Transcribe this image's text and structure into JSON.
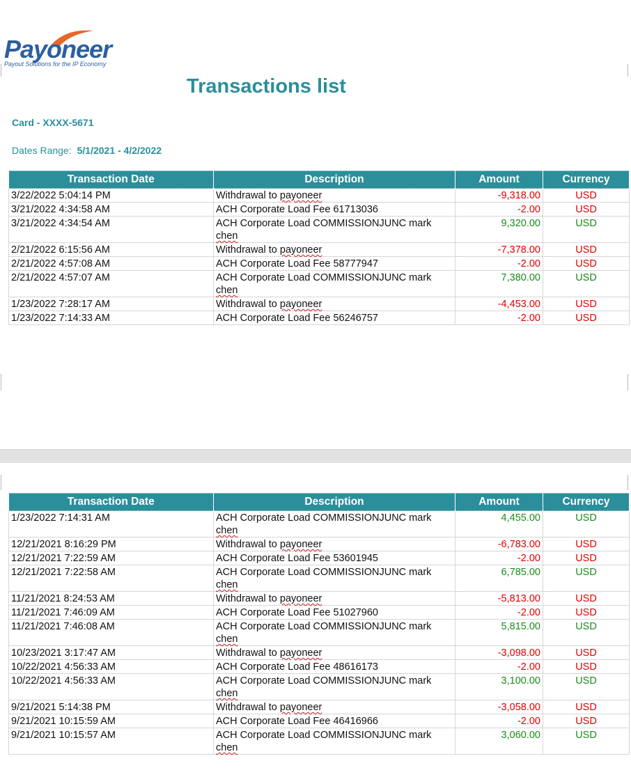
{
  "brand": {
    "name": "Payoneer",
    "tagline": "Payout Solutions for the IP Economy"
  },
  "title": "Transactions list",
  "card": "Card - XXXX-5671",
  "dates_range": {
    "label": "Dates Range:",
    "value": "5/1/2021 - 4/2/2022"
  },
  "columns": [
    "Transaction Date",
    "Description",
    "Amount",
    "Currency"
  ],
  "colors": {
    "header": "#2a8f9b",
    "negative": "#e00000",
    "positive": "#1b8a1b"
  },
  "page1_rows": [
    {
      "date": "3/22/2022 5:04:14 PM",
      "desc_a": "Withdrawal to",
      "desc_b": "payoneer",
      "amount": "-9,318.00",
      "currency": "USD",
      "sign": "neg"
    },
    {
      "date": "3/21/2022 4:34:58 AM",
      "desc_a": "ACH Corporate Load Fee 61713036",
      "desc_b": "",
      "amount": "-2.00",
      "currency": "USD",
      "sign": "neg"
    },
    {
      "date": "3/21/2022 4:34:54 AM",
      "desc_a": "ACH Corporate Load COMMISSIONJUNC mark",
      "desc_b": "chen",
      "amount": "9,320.00",
      "currency": "USD",
      "sign": "pos"
    },
    {
      "date": "2/21/2022 6:15:56 AM",
      "desc_a": "Withdrawal to",
      "desc_b": "payoneer",
      "amount": "-7,378.00",
      "currency": "USD",
      "sign": "neg"
    },
    {
      "date": "2/21/2022 4:57:08 AM",
      "desc_a": "ACH Corporate Load Fee 58777947",
      "desc_b": "",
      "amount": "-2.00",
      "currency": "USD",
      "sign": "neg"
    },
    {
      "date": "2/21/2022 4:57:07 AM",
      "desc_a": "ACH Corporate Load COMMISSIONJUNC mark",
      "desc_b": "chen",
      "amount": "7,380.00",
      "currency": "USD",
      "sign": "pos"
    },
    {
      "date": "1/23/2022 7:28:17 AM",
      "desc_a": "Withdrawal to",
      "desc_b": "payoneer",
      "amount": "-4,453.00",
      "currency": "USD",
      "sign": "neg"
    },
    {
      "date": "1/23/2022 7:14:33 AM",
      "desc_a": "ACH Corporate Load Fee 56246757",
      "desc_b": "",
      "amount": "-2.00",
      "currency": "USD",
      "sign": "neg"
    }
  ],
  "page2_rows": [
    {
      "date": "1/23/2022 7:14:31 AM",
      "desc_a": "ACH Corporate Load COMMISSIONJUNC mark",
      "desc_b": "chen",
      "amount": "4,455.00",
      "currency": "USD",
      "sign": "pos"
    },
    {
      "date": "12/21/2021 8:16:29 PM",
      "desc_a": "Withdrawal to",
      "desc_b": "payoneer",
      "amount": "-6,783.00",
      "currency": "USD",
      "sign": "neg"
    },
    {
      "date": "12/21/2021 7:22:59 AM",
      "desc_a": "ACH Corporate Load Fee 53601945",
      "desc_b": "",
      "amount": "-2.00",
      "currency": "USD",
      "sign": "neg"
    },
    {
      "date": "12/21/2021 7:22:58 AM",
      "desc_a": "ACH Corporate Load COMMISSIONJUNC mark",
      "desc_b": "chen",
      "amount": "6,785.00",
      "currency": "USD",
      "sign": "pos"
    },
    {
      "date": "11/21/2021 8:24:53 AM",
      "desc_a": "Withdrawal to",
      "desc_b": "payoneer",
      "amount": "-5,813.00",
      "currency": "USD",
      "sign": "neg"
    },
    {
      "date": "11/21/2021 7:46:09 AM",
      "desc_a": "ACH Corporate Load Fee 51027960",
      "desc_b": "",
      "amount": "-2.00",
      "currency": "USD",
      "sign": "neg"
    },
    {
      "date": "11/21/2021 7:46:08 AM",
      "desc_a": "ACH Corporate Load COMMISSIONJUNC mark",
      "desc_b": "chen",
      "amount": "5,815.00",
      "currency": "USD",
      "sign": "pos"
    },
    {
      "date": "10/23/2021 3:17:47 AM",
      "desc_a": "Withdrawal to",
      "desc_b": "payoneer",
      "amount": "-3,098.00",
      "currency": "USD",
      "sign": "neg"
    },
    {
      "date": "10/22/2021 4:56:33 AM",
      "desc_a": "ACH Corporate Load Fee 48616173",
      "desc_b": "",
      "amount": "-2.00",
      "currency": "USD",
      "sign": "neg"
    },
    {
      "date": "10/22/2021 4:56:33 AM",
      "desc_a": "ACH Corporate Load COMMISSIONJUNC mark",
      "desc_b": "chen",
      "amount": "3,100.00",
      "currency": "USD",
      "sign": "pos"
    },
    {
      "date": "9/21/2021 5:14:38 PM",
      "desc_a": "Withdrawal to",
      "desc_b": "payoneer",
      "amount": "-3,058.00",
      "currency": "USD",
      "sign": "neg"
    },
    {
      "date": "9/21/2021 10:15:59 AM",
      "desc_a": "ACH Corporate Load Fee 46416966",
      "desc_b": "",
      "amount": "-2.00",
      "currency": "USD",
      "sign": "neg"
    },
    {
      "date": "9/21/2021 10:15:57 AM",
      "desc_a": "ACH Corporate Load COMMISSIONJUNC mark",
      "desc_b": "chen",
      "amount": "3,060.00",
      "currency": "USD",
      "sign": "pos"
    }
  ]
}
